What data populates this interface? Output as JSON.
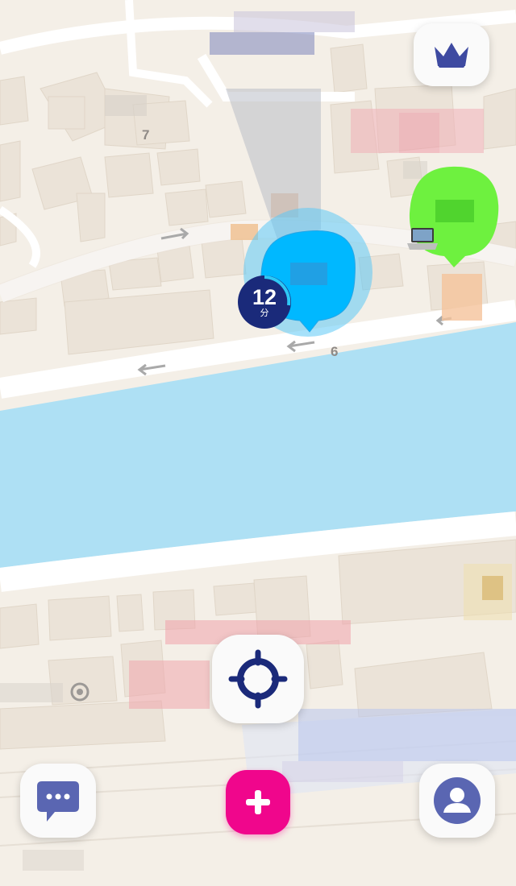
{
  "map": {
    "road_labels": [
      "7",
      "6"
    ],
    "colors": {
      "land": "#f4efe7",
      "building": "#ebe3d8",
      "river": "#aee0f4",
      "road": "#ffffff"
    }
  },
  "me_marker": {
    "timer_value": "12",
    "timer_unit": "分",
    "bubble_color": "#00b4ff",
    "timer_color": "#1a2a7a"
  },
  "friend_marker": {
    "bubble_color": "#6ef13f",
    "status_icon": "laptop-icon"
  },
  "controls": {
    "crown_button": {
      "icon": "crown-icon",
      "color": "#3e4aa1"
    },
    "locate_button": {
      "icon": "crosshair-icon",
      "color": "#1b2a7a"
    },
    "chat_button": {
      "icon": "chat-bubble-icon",
      "color": "#5a66b2"
    },
    "add_button": {
      "icon": "plus-icon",
      "color": "#f0068c"
    },
    "profile_button": {
      "icon": "user-icon",
      "color": "#5a66b2"
    }
  }
}
